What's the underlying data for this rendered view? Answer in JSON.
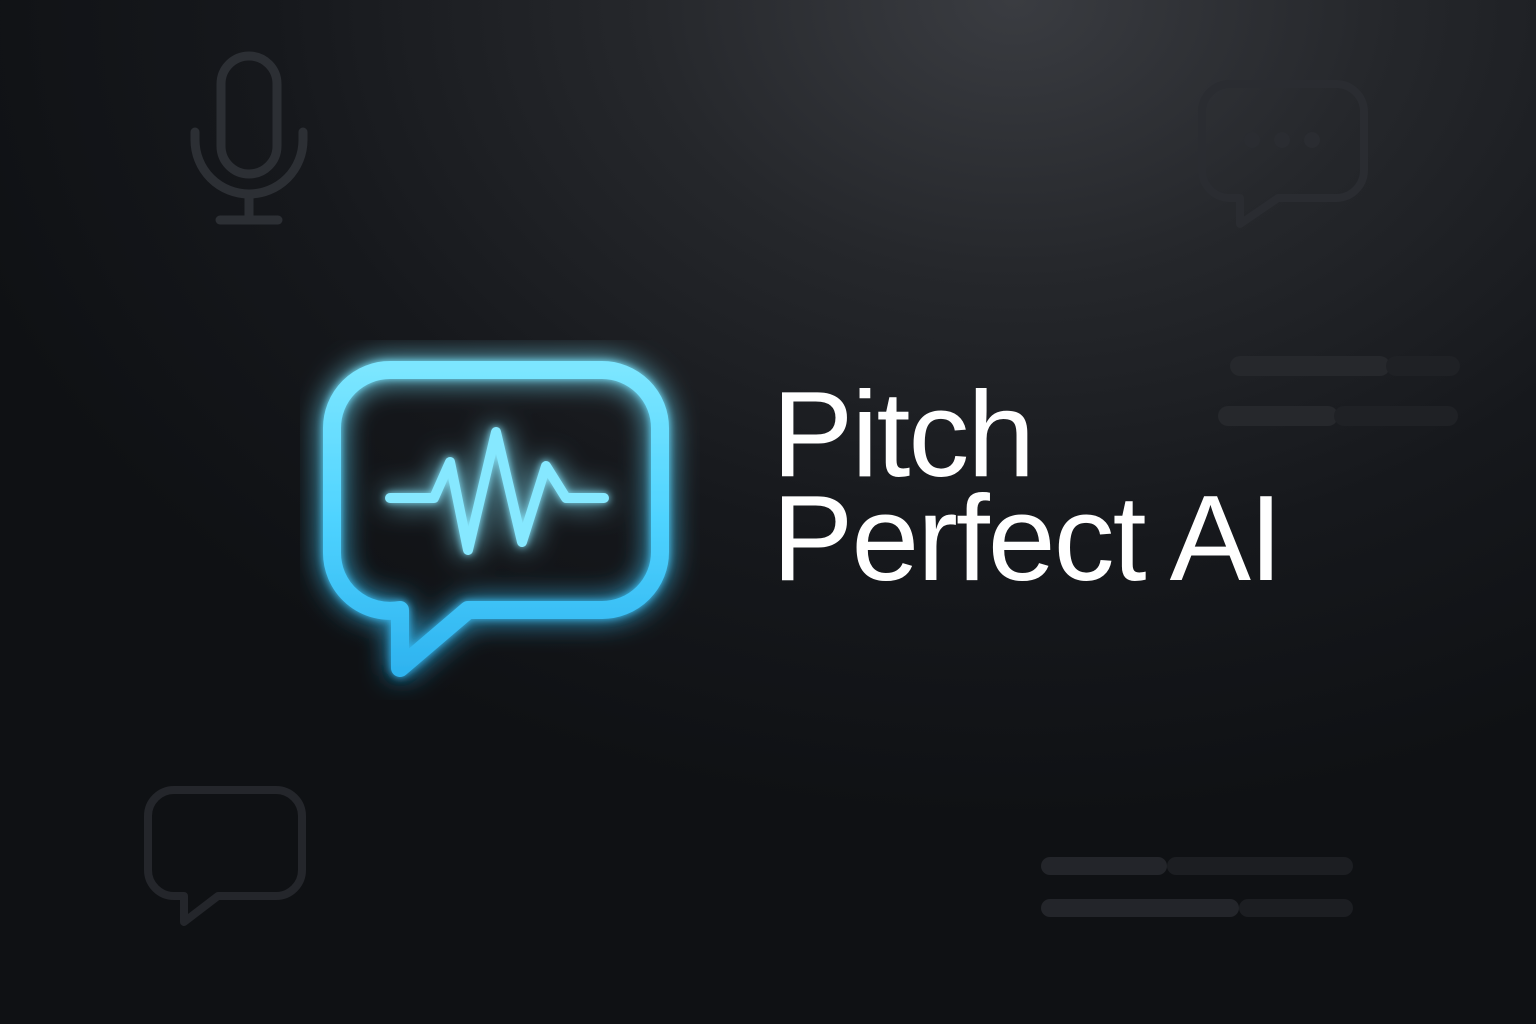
{
  "brand": {
    "name_line1": "Pitch",
    "name_line2": "Perfect AI",
    "accent_color": "#4fd3ff",
    "text_color": "#ffffff",
    "background_color": "#15171b"
  },
  "icons": {
    "logo": "speech-bubble-waveform-icon",
    "decorative": [
      "microphone-icon",
      "chat-bubble-dots-icon",
      "chat-bubble-icon",
      "text-lines-placeholder",
      "text-lines-placeholder"
    ]
  }
}
